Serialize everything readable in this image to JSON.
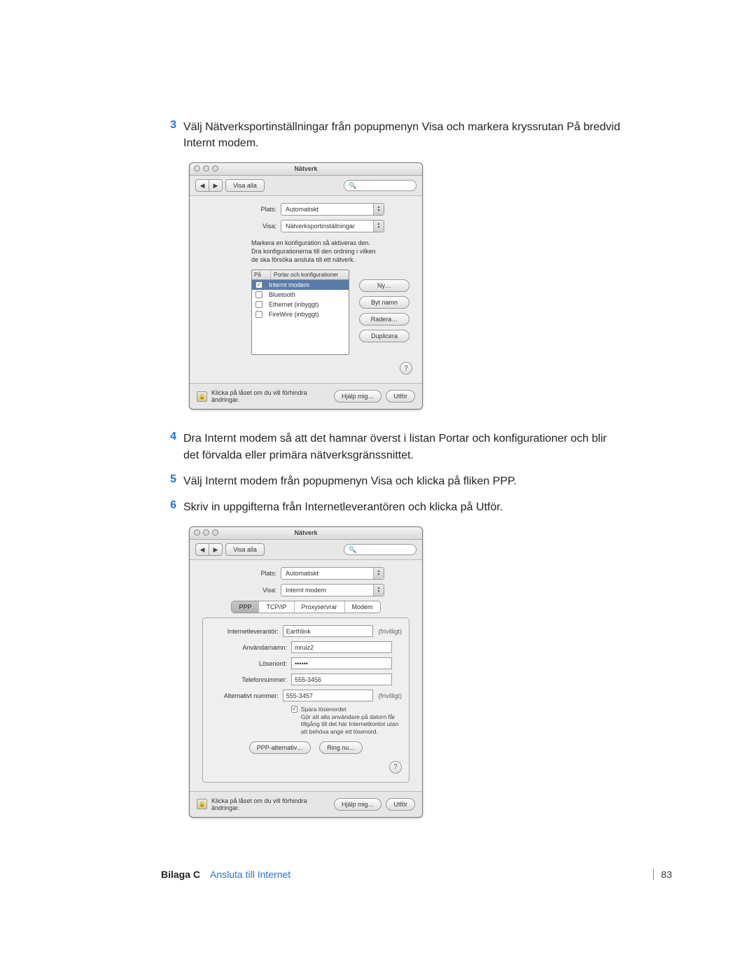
{
  "steps": {
    "s3": {
      "n": "3",
      "t": "Välj Nätverksportinställningar från popupmenyn Visa och markera kryssrutan På bredvid Internt modem."
    },
    "s4": {
      "n": "4",
      "t": "Dra Internt modem så att det hamnar överst i listan Portar och konfigurationer och blir det förvalda eller primära nätverksgränssnittet."
    },
    "s5": {
      "n": "5",
      "t": "Välj Internt modem från popupmenyn Visa och klicka på fliken PPP."
    },
    "s6": {
      "n": "6",
      "t": "Skriv in uppgifterna från Internetleverantören och klicka på Utför."
    }
  },
  "win": {
    "title": "Nätverk",
    "show_all": "Visa alla",
    "plats_label": "Plats:",
    "plats_value": "Automatiskt",
    "visa_label": "Visa:",
    "lock_text": "Klicka på låset om du vill förhindra ändringar.",
    "help_btn": "Hjälp mig…",
    "apply_btn": "Utför"
  },
  "ports": {
    "visa_value": "Nätverksportinställningar",
    "instr": "Markera en konfiguration så aktiveras den. Dra konfigurationerna till den ordning i vilken de ska försöka ansluta till ett nätverk.",
    "col_on": "På",
    "col_name": "Portar och konfigurationer",
    "rows": [
      {
        "checked": true,
        "name": "Internt modem",
        "sel": true
      },
      {
        "checked": false,
        "name": "Bluetooth",
        "sel": false
      },
      {
        "checked": false,
        "name": "Ethernet (inbyggt)",
        "sel": false
      },
      {
        "checked": false,
        "name": "FireWire (inbyggt)",
        "sel": false
      }
    ],
    "btns": {
      "new": "Ny…",
      "rename": "Byt namn",
      "delete": "Radera…",
      "dup": "Duplicera"
    }
  },
  "ppp": {
    "visa_value": "Internt modem",
    "tabs": {
      "ppp": "PPP",
      "tcpip": "TCP/IP",
      "proxy": "Proxyservrar",
      "modem": "Modem"
    },
    "fields": {
      "isp_l": "Internetleverantör:",
      "isp_v": "Earthlink",
      "isp_h": "(frivilligt)",
      "user_l": "Användarnamn:",
      "user_v": "mruiz2",
      "pass_l": "Lösenord:",
      "pass_v": "••••••",
      "tel_l": "Telefonnummer:",
      "tel_v": "555-3456",
      "alt_l": "Alternativt nummer:",
      "alt_v": "555-3457",
      "alt_h": "(frivilligt)"
    },
    "save_pw": "Spara lösenordet",
    "save_note": "Gör att alla användare på datorn får tillgång till det här Internetkontot utan att behöva ange ett lösenord.",
    "ppp_opt": "PPP-alternativ…",
    "dial": "Ring nu…"
  },
  "footer": {
    "appendix": "Bilaga C",
    "chapter": "Ansluta till Internet",
    "page": "83"
  }
}
